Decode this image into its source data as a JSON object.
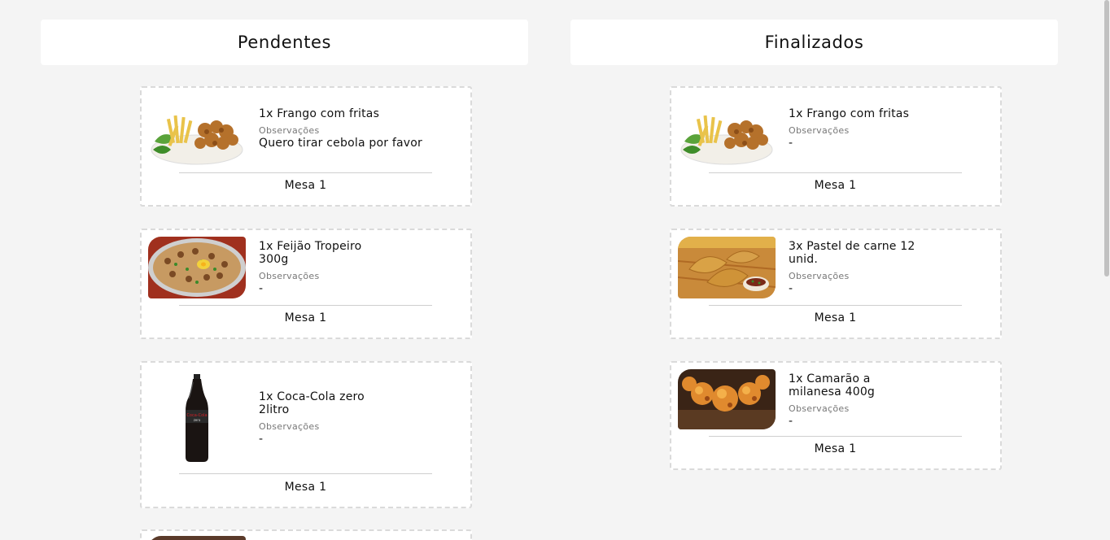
{
  "columns": {
    "pending": {
      "title": "Pendentes",
      "cards": [
        {
          "name": "1x Frango com fritas",
          "obs_label": "Observações",
          "obs": "Quero tirar cebola por favor",
          "table": "Mesa 1",
          "image": "chicken-fries-image"
        },
        {
          "name": "1x Feijão Tropeiro 300g",
          "obs_label": "Observações",
          "obs": "-",
          "table": "Mesa 1",
          "image": "feijao-tropeiro-image"
        },
        {
          "name": "1x Coca-Cola zero 2litro",
          "obs_label": "Observações",
          "obs": "-",
          "table": "Mesa 1",
          "image": "coca-cola-bottle-image"
        }
      ]
    },
    "done": {
      "title": "Finalizados",
      "cards": [
        {
          "name": "1x Frango com fritas",
          "obs_label": "Observações",
          "obs": "-",
          "table": "Mesa 1",
          "image": "chicken-fries-image"
        },
        {
          "name": "3x Pastel de carne 12 unid.",
          "obs_label": "Observações",
          "obs": "-",
          "table": "Mesa 1",
          "image": "pastel-image"
        },
        {
          "name": "1x Camarão a milanesa 400g",
          "obs_label": "Observações",
          "obs": "-",
          "table": "Mesa 1",
          "image": "fried-shrimp-image"
        }
      ]
    }
  },
  "colors": {
    "background": "#f4f4f4",
    "card": "#ffffff",
    "border": "#dadada",
    "muted_text": "#777777"
  }
}
